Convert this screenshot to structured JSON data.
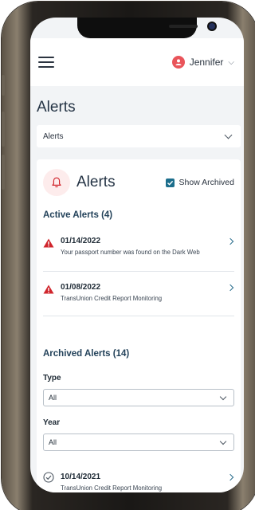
{
  "header": {
    "menu_icon": "hamburger-menu-icon",
    "user_icon": "user-icon",
    "user_name": "Jennifer",
    "user_chevron": "chevron-down-icon"
  },
  "page": {
    "title": "Alerts",
    "select_value": "Alerts"
  },
  "card": {
    "title": "Alerts",
    "show_archived_label": "Show Archived",
    "show_archived_checked": true,
    "active_title": "Active Alerts (4)",
    "active_alerts": [
      {
        "date": "01/14/2022",
        "text": "Your passport number was found on the Dark Web",
        "icon": "warning-triangle-icon"
      },
      {
        "date": "01/08/2022",
        "text": "TransUnion Credit Report Monitoring",
        "icon": "warning-triangle-icon"
      }
    ],
    "archived_title": "Archived Alerts (14)",
    "type_label": "Type",
    "type_value": "All",
    "year_label": "Year",
    "year_value": "All",
    "archived_alerts": [
      {
        "date": "10/14/2021",
        "text": "TransUnion Credit Report Monitoring",
        "icon": "check-circle-icon"
      }
    ]
  },
  "colors": {
    "accent": "#1c6e8c",
    "warning": "#d0252c",
    "heading": "#23425a"
  }
}
